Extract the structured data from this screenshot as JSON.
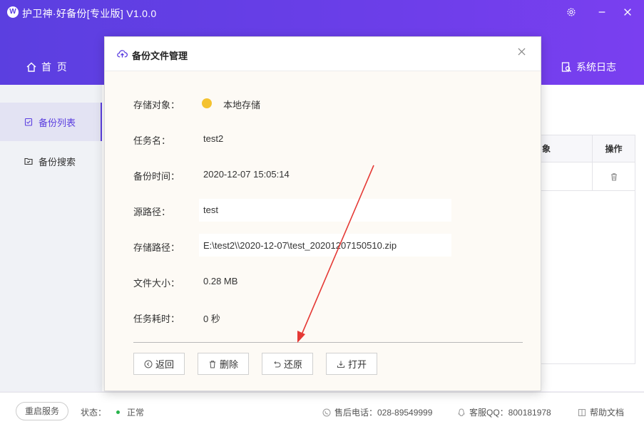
{
  "app": {
    "title": "护卫神·好备份[专业版] V1.0.0",
    "logo_letter": "W",
    "accent": "#5b3fe0"
  },
  "nav": {
    "home_label": "首  页",
    "syslog_label": "系统日志"
  },
  "sidebar": {
    "items": [
      {
        "label": "备份列表",
        "icon": "clipboard-check-icon",
        "active": true
      },
      {
        "label": "备份搜索",
        "icon": "folder-search-icon",
        "active": false
      }
    ]
  },
  "background_table": {
    "col_partial": "象",
    "col_actions": "操作"
  },
  "modal": {
    "title": "备份文件管理",
    "rows": [
      {
        "label": "存储对象：",
        "value": "本地存储"
      },
      {
        "label": "任务名：",
        "value": "test2"
      },
      {
        "label": "备份时间：",
        "value": "2020-12-07 15:05:14"
      },
      {
        "label": "源路径：",
        "value": "test"
      },
      {
        "label": "存储路径：",
        "value": "E:\\test2\\\\2020-12-07\\test_20201207150510.zip"
      },
      {
        "label": "文件大小：",
        "value": "0.28 MB"
      },
      {
        "label": "任务耗时：",
        "value": "0 秒"
      }
    ],
    "buttons": {
      "back": "返回",
      "delete": "删除",
      "restore": "还原",
      "open": "打开"
    }
  },
  "footer": {
    "restart_label": "重启服务",
    "status_label": "状态：",
    "status_value": "正常",
    "status_color": "#27b34b",
    "phone": "售后电话：028-89549999",
    "qq": "客服QQ：800181978",
    "help": "帮助文档"
  },
  "annotation_color": "#e53935"
}
